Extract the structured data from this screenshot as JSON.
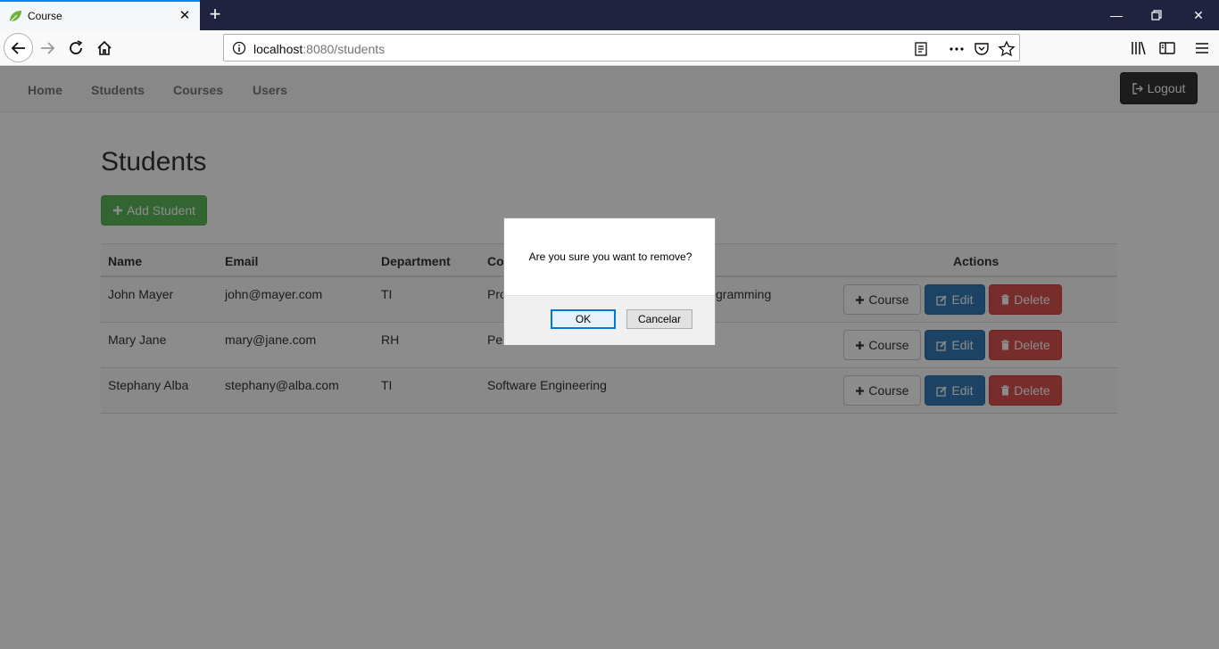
{
  "browser": {
    "tab_title": "Course",
    "url_host": "localhost",
    "url_rest": ":8080/students"
  },
  "app_nav": {
    "links": [
      "Home",
      "Students",
      "Courses",
      "Users"
    ],
    "logout_label": "Logout"
  },
  "page": {
    "title": "Students",
    "add_label": "Add Student"
  },
  "table": {
    "headers": [
      "Name",
      "Email",
      "Department",
      "Co",
      "Actions"
    ],
    "rows": [
      {
        "name": "John Mayer",
        "email": "john@mayer.com",
        "department": "TI",
        "course_left": "Pro",
        "course_right": "gramming"
      },
      {
        "name": "Mary Jane",
        "email": "mary@jane.com",
        "department": "RH",
        "course_left": "Pe",
        "course_right": ""
      },
      {
        "name": "Stephany Alba",
        "email": "stephany@alba.com",
        "department": "TI",
        "course_left": "Software Engineering",
        "course_right": ""
      }
    ],
    "action_labels": {
      "course": "Course",
      "edit": "Edit",
      "delete": "Delete"
    }
  },
  "dialog": {
    "message": "Are you sure you want to remove?",
    "ok_label": "OK",
    "cancel_label": "Cancelar"
  },
  "colors": {
    "success": "#5cb85c",
    "primary": "#337ab7",
    "danger": "#d9534f",
    "dark": "#333333"
  }
}
